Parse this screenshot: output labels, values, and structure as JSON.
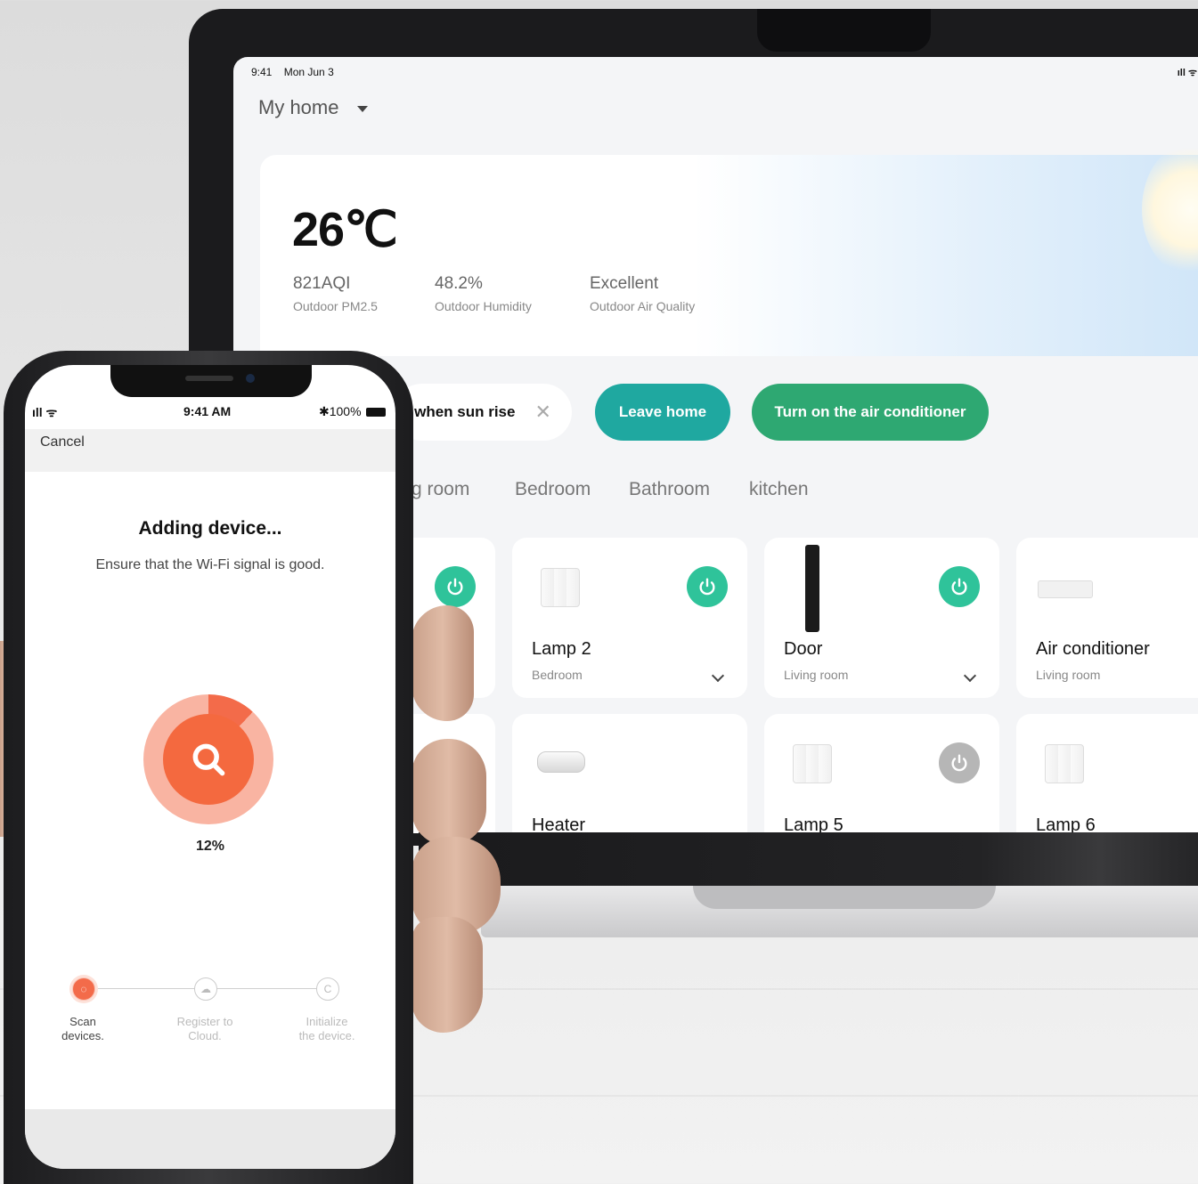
{
  "tablet": {
    "status_time": "9:41",
    "status_date": "Mon Jun 3",
    "home_name": "My home",
    "weather": {
      "temperature": "26℃",
      "metrics": [
        {
          "value": "821AQI",
          "label": "Outdoor PM2.5"
        },
        {
          "value": "48.2%",
          "label": "Outdoor Humidity"
        },
        {
          "value": "Excellent",
          "label": "Outdoor Air Quality"
        }
      ]
    },
    "scenes": [
      "when sun rise",
      "Leave home",
      "Turn on the air conditioner"
    ],
    "scene_close_icon": "close-icon",
    "rooms": [
      "g room",
      "Bedroom",
      "Bathroom",
      "kitchen"
    ],
    "devices": [
      {
        "name": "Lamp 2",
        "room": "Bedroom",
        "power": "on",
        "icon": "wall-switch-icon"
      },
      {
        "name": "Door",
        "room": "Living room",
        "power": "on",
        "icon": "smart-lock-icon"
      },
      {
        "name": "Air conditioner",
        "room": "Living room",
        "power": "none",
        "icon": "air-conditioner-icon"
      },
      {
        "name": "Heater",
        "room": "",
        "power": "none",
        "icon": "water-heater-icon"
      },
      {
        "name": "Lamp 5",
        "room": "",
        "power": "off",
        "icon": "wall-switch-icon"
      },
      {
        "name": "Lamp 6",
        "room": "",
        "power": "off",
        "icon": "wall-switch-icon"
      }
    ],
    "colors": {
      "teal": "#1fa8a0",
      "green": "#2ea872",
      "power_on": "#2fc39a",
      "power_off": "#b6b6b6"
    }
  },
  "phone": {
    "time": "9:41 AM",
    "battery": "100%",
    "cancel_label": "Cancel",
    "title": "Adding device...",
    "subtitle": "Ensure that the Wi-Fi signal is good.",
    "progress_percent": "12%",
    "progress_value": 0.12,
    "steps": [
      {
        "line1": "Scan",
        "line2": "devices.",
        "active": true
      },
      {
        "line1": "Register to",
        "line2": "Cloud.",
        "active": false
      },
      {
        "line1": "Initialize",
        "line2": "the device.",
        "active": false
      }
    ],
    "colors": {
      "accent": "#f36b4a"
    }
  }
}
